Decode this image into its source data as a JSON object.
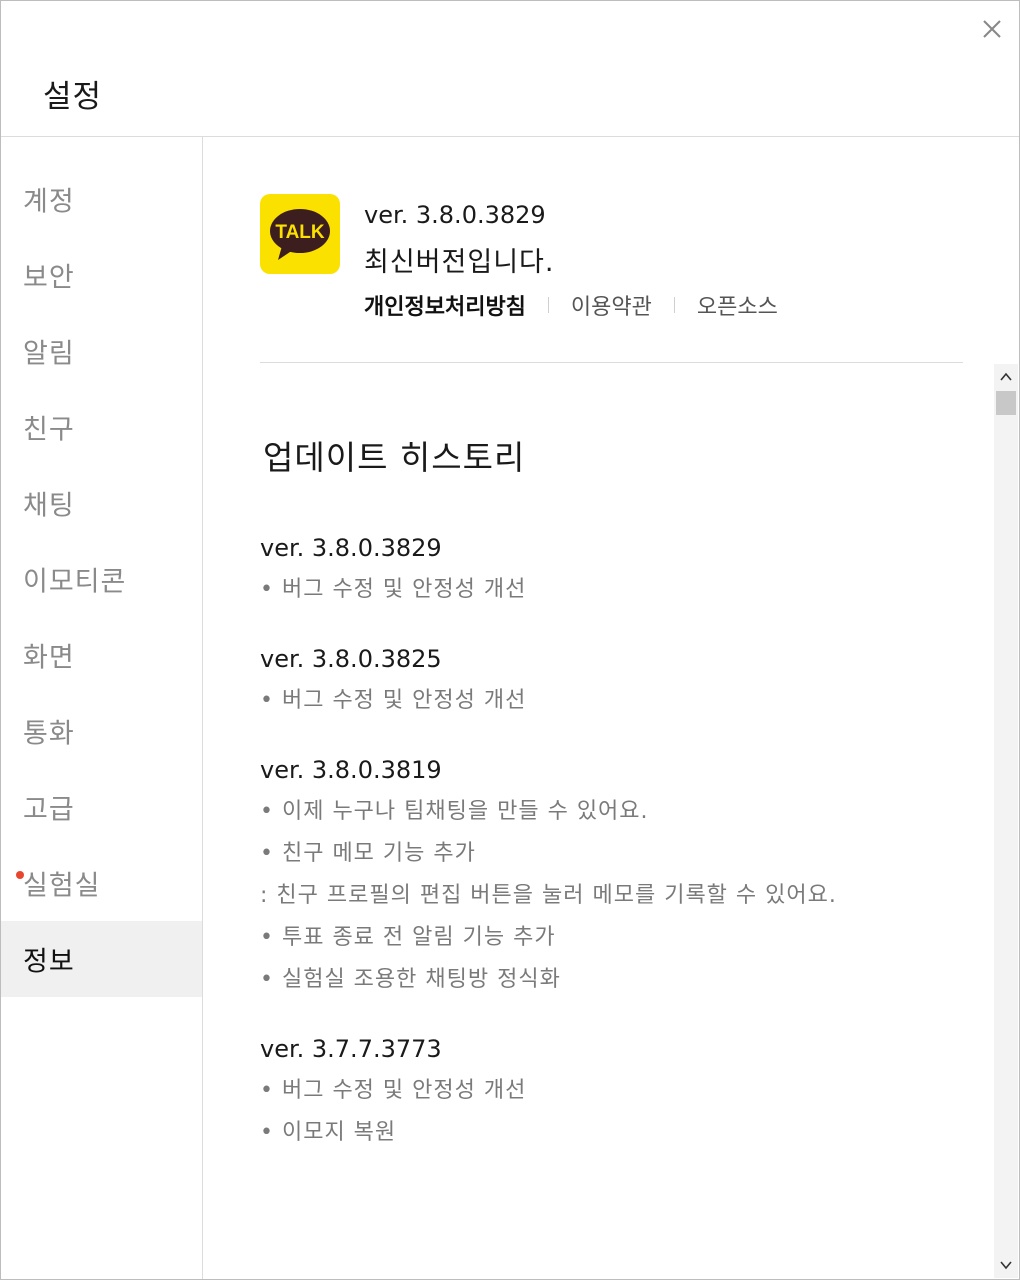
{
  "window": {
    "title": "설정",
    "close_icon": "close-icon"
  },
  "sidebar": {
    "items": [
      {
        "label": "계정"
      },
      {
        "label": "보안"
      },
      {
        "label": "알림"
      },
      {
        "label": "친구"
      },
      {
        "label": "채팅"
      },
      {
        "label": "이모티콘"
      },
      {
        "label": "화면"
      },
      {
        "label": "통화"
      },
      {
        "label": "고급"
      },
      {
        "label": "실험실",
        "badge": "new-dot"
      },
      {
        "label": "정보",
        "active": true
      }
    ]
  },
  "info": {
    "logo_text": "TALK",
    "logo_color": "#fae100",
    "version": "ver. 3.8.0.3829",
    "status": "최신버전입니다.",
    "links": [
      {
        "label": "개인정보처리방침"
      },
      {
        "label": "이용약관"
      },
      {
        "label": "오픈소스"
      }
    ]
  },
  "history": {
    "title": "업데이트 히스토리",
    "entries": [
      {
        "version": "ver. 3.8.0.3829",
        "notes": [
          "• 버그 수정 및 안정성 개선"
        ]
      },
      {
        "version": "ver. 3.8.0.3825",
        "notes": [
          "• 버그 수정 및 안정성 개선"
        ]
      },
      {
        "version": "ver. 3.8.0.3819",
        "notes": [
          "• 이제 누구나 팀채팅을 만들 수 있어요.",
          "• 친구 메모 기능 추가",
          ": 친구 프로필의 편집 버튼을 눌러 메모를 기록할 수 있어요.",
          "• 투표 종료 전 알림 기능 추가",
          "• 실험실 조용한 채팅방 정식화"
        ]
      },
      {
        "version": "ver. 3.7.7.3773",
        "notes": [
          "• 버그 수정 및 안정성 개선",
          "• 이모지 복원"
        ]
      }
    ]
  },
  "colors": {
    "accent": "#fae100",
    "badge": "#e8462f",
    "muted_text": "#8a8a8a"
  }
}
